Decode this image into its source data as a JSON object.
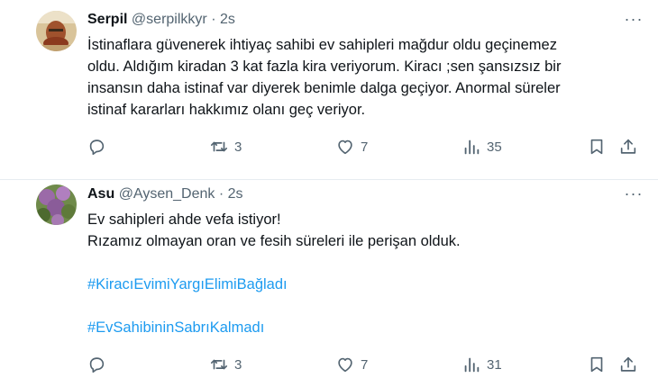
{
  "tweets": [
    {
      "author_name": "Serpil",
      "author_handle": "@serpilkkyr",
      "separator": "·",
      "time": "2s",
      "more_glyph": "···",
      "lines": [
        "İstinaflara güvenerek ihtiyaç sahibi ev sahipleri mağdur oldu geçinemez",
        "oldu. Aldığım kiradan 3 kat fazla kira veriyorum. Kiracı ;sen şansızsız bir",
        "insansın daha istinaf var diyerek benimle dalga geçiyor.  Anormal süreler",
        "istinaf kararları hakkımız olanı geç veriyor."
      ],
      "retweets": "3",
      "likes": "7",
      "views": "35"
    },
    {
      "author_name": "Asu",
      "author_handle": "@Aysen_Denk",
      "separator": "·",
      "time": "2s",
      "more_glyph": "···",
      "lines": [
        "Ev sahipleri ahde vefa istiyor!",
        "Rızamız olmayan oran ve fesih süreleri ile perişan olduk."
      ],
      "hashtags": [
        "#KiracıEvimiYargıElimiBağladı",
        "#EvSahibininSabrıKalmadı"
      ],
      "retweets": "3",
      "likes": "7",
      "views": "31"
    }
  ],
  "icons": {
    "reply": "reply-icon",
    "retweet": "retweet-icon",
    "like": "heart-icon",
    "views": "views-icon",
    "bookmark": "bookmark-icon",
    "share": "share-icon"
  },
  "colors": {
    "text": "#0f1419",
    "secondary": "#536471",
    "link": "#1d9bf0",
    "divider": "#e6ecf0"
  }
}
